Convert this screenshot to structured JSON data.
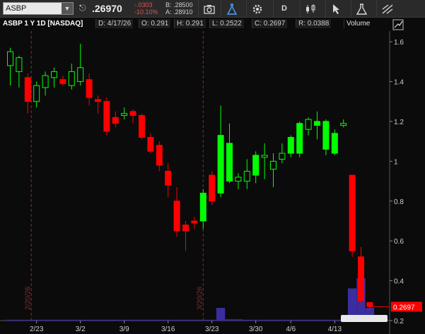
{
  "toolbar": {
    "symbol": "ASBP",
    "last": ".26970",
    "change": "-.0303",
    "change_pct": "-10.10%",
    "bid": "B: .28500",
    "ask": "A: .28910",
    "timeframe_btn": "D"
  },
  "header": {
    "title": "ASBP 1 Y 1D [NASDAQ]",
    "date": "D: 4/17/26",
    "open": "O: 0.291",
    "high": "H: 0.291",
    "low": "L: 0.2522",
    "close": "C: 0.2697",
    "range": "R: 0.0388",
    "study": "Volume"
  },
  "colors": {
    "up": "#00ff00",
    "down": "#ff0000",
    "volume": "#3a2d9e",
    "annotation": "#8a2a2a",
    "last_price_bubble": "#ff0000"
  },
  "chart_data": {
    "type": "candlestick",
    "ylim": [
      0.2,
      1.65
    ],
    "y_ticks": [
      0.2,
      0.4,
      0.6,
      0.8,
      1,
      1.2,
      1.4,
      1.6
    ],
    "y_tick_labels": [
      "0.2",
      "0.4",
      "0.6",
      "0.8",
      "1",
      "1.2",
      "1.4",
      "1.6"
    ],
    "x_tick_labels": [
      {
        "index": 3,
        "label": "2/23"
      },
      {
        "index": 8,
        "label": "3/2"
      },
      {
        "index": 13,
        "label": "3/9"
      },
      {
        "index": 18,
        "label": "3/16"
      },
      {
        "index": 23,
        "label": "3/23"
      },
      {
        "index": 28,
        "label": "3/30"
      },
      {
        "index": 32,
        "label": "4/6"
      },
      {
        "index": 37,
        "label": "4/13"
      }
    ],
    "annotations": [
      {
        "index": 2.4,
        "label": "2/20/26"
      },
      {
        "index": 22.0,
        "label": "3/20/26"
      }
    ],
    "last_price_label": "0.2697",
    "candles": [
      {
        "o": 1.48,
        "h": 1.57,
        "l": 1.38,
        "c": 1.55,
        "dir": "up"
      },
      {
        "o": 1.45,
        "h": 1.53,
        "l": 1.37,
        "c": 1.52,
        "dir": "up"
      },
      {
        "o": 1.42,
        "h": 1.44,
        "l": 1.24,
        "c": 1.3,
        "dir": "down"
      },
      {
        "o": 1.3,
        "h": 1.4,
        "l": 1.27,
        "c": 1.38,
        "dir": "up"
      },
      {
        "o": 1.37,
        "h": 1.45,
        "l": 1.33,
        "c": 1.43,
        "dir": "up"
      },
      {
        "o": 1.42,
        "h": 1.47,
        "l": 1.37,
        "c": 1.45,
        "dir": "up"
      },
      {
        "o": 1.41,
        "h": 1.43,
        "l": 1.38,
        "c": 1.39,
        "dir": "down"
      },
      {
        "o": 1.38,
        "h": 1.49,
        "l": 1.36,
        "c": 1.45,
        "dir": "up"
      },
      {
        "o": 1.4,
        "h": 1.59,
        "l": 1.38,
        "c": 1.47,
        "dir": "up"
      },
      {
        "o": 1.41,
        "h": 1.44,
        "l": 1.28,
        "c": 1.32,
        "dir": "down"
      },
      {
        "o": 1.31,
        "h": 1.33,
        "l": 1.24,
        "c": 1.3,
        "dir": "down"
      },
      {
        "o": 1.3,
        "h": 1.32,
        "l": 1.13,
        "c": 1.15,
        "dir": "down"
      },
      {
        "o": 1.22,
        "h": 1.25,
        "l": 1.17,
        "c": 1.19,
        "dir": "down"
      },
      {
        "o": 1.23,
        "h": 1.27,
        "l": 1.21,
        "c": 1.24,
        "dir": "up"
      },
      {
        "o": 1.25,
        "h": 1.26,
        "l": 1.19,
        "c": 1.23,
        "dir": "down"
      },
      {
        "o": 1.23,
        "h": 1.24,
        "l": 1.11,
        "c": 1.12,
        "dir": "down"
      },
      {
        "o": 1.12,
        "h": 1.14,
        "l": 1.04,
        "c": 1.05,
        "dir": "down"
      },
      {
        "o": 1.08,
        "h": 1.1,
        "l": 0.95,
        "c": 0.98,
        "dir": "down"
      },
      {
        "o": 0.95,
        "h": 0.99,
        "l": 0.82,
        "c": 0.88,
        "dir": "down"
      },
      {
        "o": 0.8,
        "h": 0.87,
        "l": 0.62,
        "c": 0.65,
        "dir": "down"
      },
      {
        "o": 0.68,
        "h": 0.7,
        "l": 0.55,
        "c": 0.65,
        "dir": "down"
      },
      {
        "o": 0.7,
        "h": 0.72,
        "l": 0.66,
        "c": 0.69,
        "dir": "down"
      },
      {
        "o": 0.7,
        "h": 0.86,
        "l": 0.66,
        "c": 0.84,
        "dir": "up"
      },
      {
        "o": 0.93,
        "h": 0.95,
        "l": 0.78,
        "c": 0.8,
        "dir": "down"
      },
      {
        "o": 0.84,
        "h": 1.28,
        "l": 0.82,
        "c": 1.13,
        "dir": "up"
      },
      {
        "o": 0.9,
        "h": 1.19,
        "l": 0.89,
        "c": 1.09,
        "dir": "up"
      },
      {
        "o": 0.9,
        "h": 0.94,
        "l": 0.86,
        "c": 0.92,
        "dir": "up"
      },
      {
        "o": 0.9,
        "h": 1.01,
        "l": 0.86,
        "c": 0.95,
        "dir": "up"
      },
      {
        "o": 0.93,
        "h": 1.05,
        "l": 0.89,
        "c": 1.03,
        "dir": "up"
      },
      {
        "o": 1.02,
        "h": 1.09,
        "l": 0.91,
        "c": 1.03,
        "dir": "up"
      },
      {
        "o": 0.96,
        "h": 1.04,
        "l": 0.87,
        "c": 1.0,
        "dir": "up"
      },
      {
        "o": 1.01,
        "h": 1.09,
        "l": 0.99,
        "c": 1.04,
        "dir": "up"
      },
      {
        "o": 1.04,
        "h": 1.13,
        "l": 1.02,
        "c": 1.12,
        "dir": "up"
      },
      {
        "o": 1.04,
        "h": 1.2,
        "l": 1.02,
        "c": 1.19,
        "dir": "up"
      },
      {
        "o": 1.16,
        "h": 1.22,
        "l": 1.13,
        "c": 1.21,
        "dir": "up"
      },
      {
        "o": 1.2,
        "h": 1.25,
        "l": 1.11,
        "c": 1.18,
        "dir": "up"
      },
      {
        "o": 1.2,
        "h": 1.21,
        "l": 1.03,
        "c": 1.06,
        "dir": "up"
      },
      {
        "o": 1.04,
        "h": 1.16,
        "l": 1.03,
        "c": 1.14,
        "dir": "up"
      },
      {
        "o": 1.18,
        "h": 1.21,
        "l": 1.17,
        "c": 1.19,
        "dir": "up"
      },
      {
        "o": 0.93,
        "h": 0.93,
        "l": 0.52,
        "c": 0.55,
        "dir": "down"
      },
      {
        "o": 0.52,
        "h": 0.57,
        "l": 0.28,
        "c": 0.3,
        "dir": "down"
      },
      {
        "o": 0.291,
        "h": 0.291,
        "l": 0.2522,
        "c": 0.2697,
        "dir": "down"
      }
    ],
    "volume_max": 100,
    "volume": [
      2,
      2,
      2,
      2,
      2,
      2,
      2,
      2,
      2,
      2,
      2,
      2,
      2,
      2,
      2,
      2,
      2,
      2,
      2,
      2,
      2,
      2,
      2,
      2,
      30,
      3,
      3,
      2,
      2,
      2,
      2,
      2,
      2,
      2,
      2,
      2,
      2,
      2,
      2,
      76,
      100,
      30
    ]
  }
}
